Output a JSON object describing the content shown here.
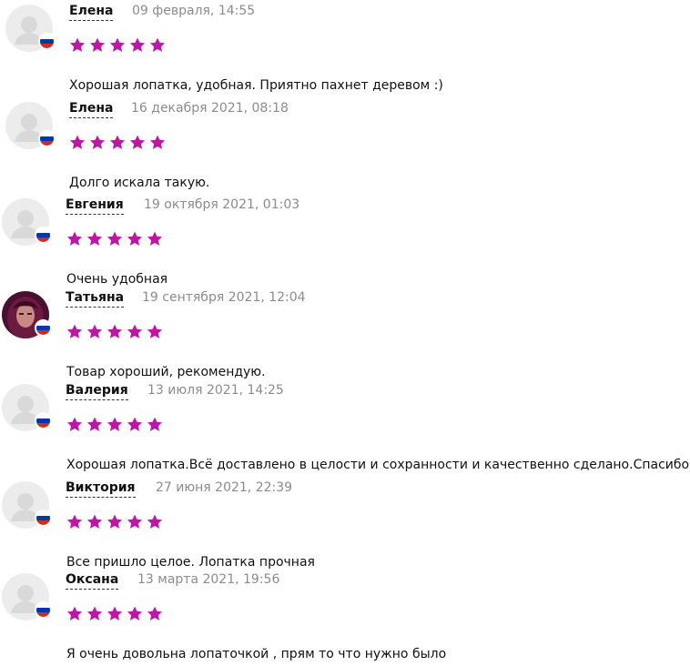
{
  "reviews": [
    {
      "name": "Елена",
      "date": "09 февраля, 14:55",
      "rating": 5,
      "text": "Хорошая лопатка, удобная. Приятно пахнет деревом :)",
      "avatar": "default-avatar-icon",
      "flag": "russia-flag-icon"
    },
    {
      "name": "Елена",
      "date": "16 декабря 2021, 08:18",
      "rating": 5,
      "text": "Долго искала такую.",
      "avatar": "default-avatar-icon",
      "flag": "russia-flag-icon"
    },
    {
      "name": "Евгения",
      "date": "19 октября 2021, 01:03",
      "rating": 5,
      "text": "Очень удобная",
      "avatar": "default-avatar-icon",
      "flag": "russia-flag-icon"
    },
    {
      "name": "Татьяна",
      "date": "19 сентября 2021, 12:04",
      "rating": 5,
      "text": "Товар хороший, рекомендую.",
      "avatar": "user-photo",
      "flag": "russia-flag-icon"
    },
    {
      "name": "Валерия",
      "date": "13 июля 2021, 14:25",
      "rating": 5,
      "text": "Хорошая лопатка.Всё доставлено в целости и сохранности и качественно сделано.Спасибо!",
      "avatar": "default-avatar-icon",
      "flag": "russia-flag-icon"
    },
    {
      "name": "Виктория",
      "date": "27 июня 2021, 22:39",
      "rating": 5,
      "text": "Все пришло целое. Лопатка прочная",
      "avatar": "default-avatar-icon",
      "flag": "russia-flag-icon"
    },
    {
      "name": "Оксана",
      "date": "13 марта 2021, 19:56",
      "rating": 5,
      "text": "Я очень довольна лопаточкой , прям то что нужно было",
      "avatar": "default-avatar-icon",
      "flag": "russia-flag-icon"
    }
  ],
  "colors": {
    "star": "#c015a8",
    "date": "#8c8c8c",
    "avatar_bg": "#ececec"
  }
}
